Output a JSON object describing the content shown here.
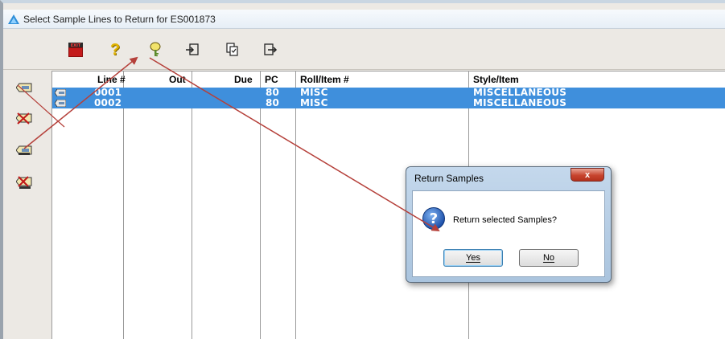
{
  "window": {
    "title": "Select Sample Lines to Return for ES001873"
  },
  "toolbar": {
    "exit_label": "EXIT",
    "buttons": [
      "exit-icon",
      "help-icon",
      "key-icon",
      "import-icon",
      "copy-icon",
      "export-icon"
    ]
  },
  "sidebar": {
    "buttons": [
      "tag-icon",
      "tag-delete-icon",
      "tag-return-icon",
      "tag-print-icon"
    ]
  },
  "grid": {
    "headers": {
      "line": "Line #",
      "out": "Out",
      "due": "Due",
      "pc": "PC",
      "roll": "Roll/Item #",
      "style": "Style/Item"
    },
    "rows": [
      {
        "line": "0001",
        "pc": "80",
        "roll": "MISC",
        "style": "MISCELLANEOUS"
      },
      {
        "line": "0002",
        "pc": "80",
        "roll": "MISC",
        "style": "MISCELLANEOUS"
      }
    ]
  },
  "dialog": {
    "title": "Return Samples",
    "close_label": "x",
    "message": "Return selected Samples?",
    "yes_label": "Yes",
    "no_label": "No"
  },
  "colors": {
    "selection": "#3f8fdc",
    "annotation_arrow": "#b5403a"
  }
}
